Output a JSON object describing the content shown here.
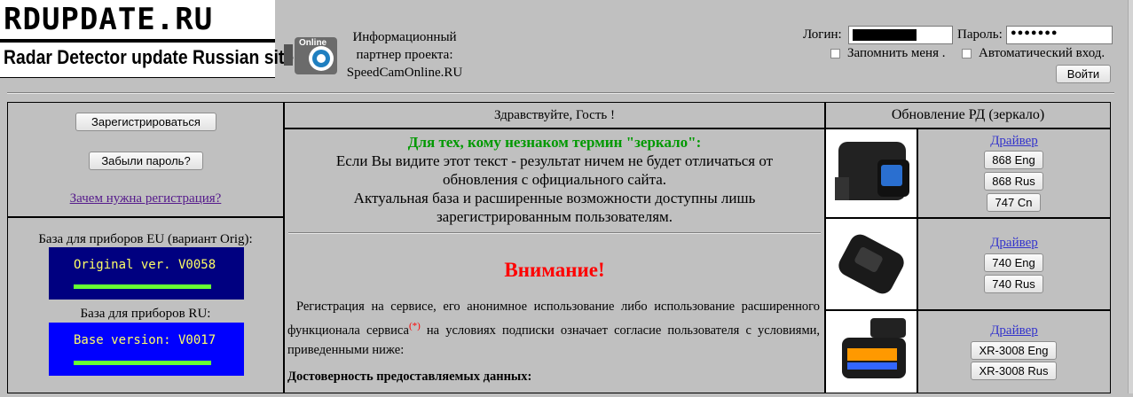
{
  "header": {
    "logo_title": "RDUPDATE.RU",
    "logo_subtitle": "Radar Detector update Russian site",
    "partner_line1": "Информационный",
    "partner_line2": "партнер проекта:",
    "partner_line3": "SpeedCamOnline.RU",
    "cam_logo_text": "Online"
  },
  "login": {
    "login_label": "Логин:",
    "login_value": "",
    "password_label": "Пароль:",
    "password_value": "●●●●●●●",
    "remember_label": "Запомнить меня .",
    "auto_label": "Автоматический вход.",
    "submit_label": "Войти"
  },
  "left": {
    "register_button": "Зарегистрироваться",
    "forgot_button": "Забыли пароль?",
    "why_register_link": "Зачем нужна регистрация?",
    "eu_label": "База для приборов EU (вариант Orig):",
    "eu_version": "Original ver. V0058",
    "ru_label": "База для приборов RU:",
    "ru_version": "Base version: V0017"
  },
  "center": {
    "greeting": "Здравствуйте, Гость !",
    "mirror_title": "Для тех, кому незнаком термин \"зеркало\":",
    "mirror_l1": "Если Вы видите этот текст - результат ничем не будет отличаться от",
    "mirror_l2": "обновления с официального сайта.",
    "mirror_l3": "Актуальная база и расширенные возможности доступны лишь",
    "mirror_l4": "зарегистрированным пользователям.",
    "attention": "Внимание!",
    "terms_a": "Регистрация на сервисе, его анонимное использование либо использование расширенного функционала сервиса",
    "terms_mark": "(*)",
    "terms_b": " на условиях подписки означает согласие пользователя с условиями, приведенными ниже:",
    "section_title": "Достоверность предоставляемых данных:"
  },
  "right": {
    "title": "Обновление РД (зеркало)",
    "devices": [
      {
        "driver": "Драйвер",
        "buttons": [
          "868 Eng",
          "868 Rus",
          "747 Cn"
        ]
      },
      {
        "driver": "Драйвер",
        "buttons": [
          "740 Eng",
          "740 Rus"
        ]
      },
      {
        "driver": "Драйвер",
        "buttons": [
          "XR-3008 Eng",
          "XR-3008 Rus"
        ]
      }
    ]
  },
  "colors": {
    "eu_lcd": "#000080",
    "ru_lcd": "#0000ff",
    "meter": "#66ff33",
    "lcd_text": "#ffff66"
  }
}
